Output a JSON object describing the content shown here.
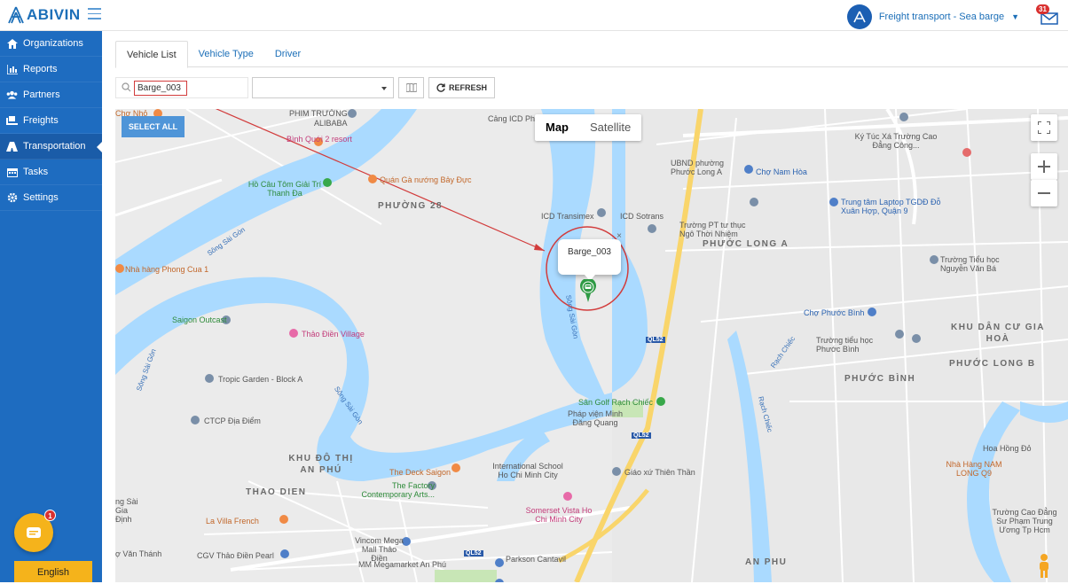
{
  "app": {
    "logo_text": "ABIVIN"
  },
  "header": {
    "tenant_name": "Freight transport - Sea barge",
    "notification_count": "31"
  },
  "sidebar": {
    "items": [
      {
        "label": "Organizations",
        "icon": "home-icon"
      },
      {
        "label": "Reports",
        "icon": "bar-chart-icon"
      },
      {
        "label": "Partners",
        "icon": "users-icon"
      },
      {
        "label": "Freights",
        "icon": "freight-icon"
      },
      {
        "label": "Transportation",
        "icon": "road-icon",
        "active": true
      },
      {
        "label": "Tasks",
        "icon": "calendar-icon"
      },
      {
        "label": "Settings",
        "icon": "gear-icon"
      }
    ],
    "chat_badge": "1",
    "language": "English"
  },
  "tabs": [
    "Vehicle List",
    "Vehicle Type",
    "Driver"
  ],
  "filters": {
    "search_value": "Barge_003",
    "type_select_value": "",
    "refresh_label": "REFRESH"
  },
  "map": {
    "select_all_label": "SELECT ALL",
    "map_type": [
      "Map",
      "Satellite"
    ],
    "popup_label": "Barge_003",
    "labels": {
      "phim_truong": "PHIM TRƯỜNG",
      "alibaba": "ALIBABA",
      "chuong_nho": "Chợ Nhỏ",
      "cang_icd": "Cảng ICD Ph",
      "binh_quoi": "Bình Quới 2 resort",
      "quan_ga": "Quán Gà nướng Bảy Đực",
      "ho_cau": "Hồ Câu Tôm Giải Trí Thanh Đa",
      "phuong_28": "PHƯỜNG 28",
      "icd_transimex": "ICD Transimex",
      "icd_sotrans": "ICD Sotrans",
      "ubnd": "UBND phường Phước Long A",
      "cho_nam_hoa": "Chợ Nam Hòa",
      "ky_tuc_xa": "Ký Túc Xá Trường Cao Đẳng Công...",
      "tgdd": "Trung tâm Laptop TGDĐ Đỗ Xuân Hợp, Quận 9",
      "truong_pt": "Trường PT tư thục Ngô Thời Nhiệm",
      "phuoc_long_a": "PHƯỚC LONG A",
      "truong_tieu_hoc_nvb": "Trường Tiểu học Nguyễn Văn Bá",
      "nha_hang_phong_cua": "Nhà hàng Phong Cua 1",
      "saigon_outcast": "Saigon Outcast",
      "thao_dien_village": "Thảo Điền Village",
      "tropic_garden": "Tropic Garden - Block A",
      "ctcp": "CTCP Địa Điểm",
      "song_sai_gon": "Sông Sài Gòn",
      "cho_phuoc_binh": "Chợ Phước Bình",
      "khu_dan_cu": "KHU DÂN CƯ GIA HOÀ",
      "truong_tieu_hoc_pb": "Trường tiểu học Phước Bình",
      "phuoc_long_b": "PHƯỚC LONG B",
      "phuoc_binh": "PHƯỚC BÌNH",
      "san_golf": "Sân Golf Rạch Chiếc",
      "phap_vien": "Pháp viện Minh Đăng Quang",
      "an_phu_do_thi": "KHU ĐÔ THỊ AN PHÚ",
      "deck_saigon": "The Deck Saigon",
      "factory": "The Factory Contemporary Arts...",
      "intl_school": "International School Ho Chi Minh City",
      "giao_xu": "Giáo xứ Thiên Thần",
      "thao_dien": "THAO DIEN",
      "la_villa": "La Villa French",
      "somerset": "Somerset Vista Ho Chi Minh City",
      "vincom": "Vincom Mega Mall Thảo Điền",
      "cgv": "CGV Thảo Điền Pearl",
      "mm_mega": "MM Megamarket An Phú",
      "parkson": "Parkson Cantavil",
      "an_phu": "AN PHU",
      "nha_hang_nam_long": "Nhà Hàng NAM LONG Q9",
      "hoa_hong_do": "Hoa Hồng Đỏ",
      "truong_cao_dang": "Trường Cao Đẳng Sư Phạm Trung Ương Tp Hcm",
      "rach_chiec": "Rạch Chiếc",
      "ql52": "QL52",
      "van_thanh": "ợ Văn Thánh",
      "gia_dinh": "ng Sài Gia Định"
    }
  },
  "colors": {
    "sidebar": "#1e6cc0",
    "accent": "#1c6fb8",
    "water": "#aadaff",
    "highway": "#f9d56b",
    "lang_button": "#f5b31b",
    "annotation": "#d23c3c"
  }
}
